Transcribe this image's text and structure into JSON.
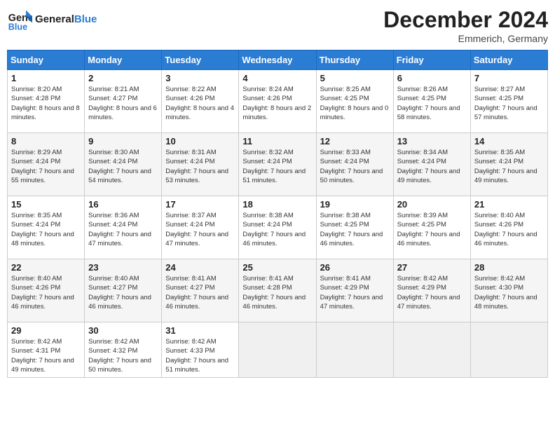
{
  "header": {
    "logo_text_1": "General",
    "logo_text_2": "Blue",
    "month": "December 2024",
    "location": "Emmerich, Germany"
  },
  "weekdays": [
    "Sunday",
    "Monday",
    "Tuesday",
    "Wednesday",
    "Thursday",
    "Friday",
    "Saturday"
  ],
  "weeks": [
    [
      {
        "day": "1",
        "sunrise": "8:20 AM",
        "sunset": "4:28 PM",
        "daylight": "8 hours and 8 minutes."
      },
      {
        "day": "2",
        "sunrise": "8:21 AM",
        "sunset": "4:27 PM",
        "daylight": "8 hours and 6 minutes."
      },
      {
        "day": "3",
        "sunrise": "8:22 AM",
        "sunset": "4:26 PM",
        "daylight": "8 hours and 4 minutes."
      },
      {
        "day": "4",
        "sunrise": "8:24 AM",
        "sunset": "4:26 PM",
        "daylight": "8 hours and 2 minutes."
      },
      {
        "day": "5",
        "sunrise": "8:25 AM",
        "sunset": "4:25 PM",
        "daylight": "8 hours and 0 minutes."
      },
      {
        "day": "6",
        "sunrise": "8:26 AM",
        "sunset": "4:25 PM",
        "daylight": "7 hours and 58 minutes."
      },
      {
        "day": "7",
        "sunrise": "8:27 AM",
        "sunset": "4:25 PM",
        "daylight": "7 hours and 57 minutes."
      }
    ],
    [
      {
        "day": "8",
        "sunrise": "8:29 AM",
        "sunset": "4:24 PM",
        "daylight": "7 hours and 55 minutes."
      },
      {
        "day": "9",
        "sunrise": "8:30 AM",
        "sunset": "4:24 PM",
        "daylight": "7 hours and 54 minutes."
      },
      {
        "day": "10",
        "sunrise": "8:31 AM",
        "sunset": "4:24 PM",
        "daylight": "7 hours and 53 minutes."
      },
      {
        "day": "11",
        "sunrise": "8:32 AM",
        "sunset": "4:24 PM",
        "daylight": "7 hours and 51 minutes."
      },
      {
        "day": "12",
        "sunrise": "8:33 AM",
        "sunset": "4:24 PM",
        "daylight": "7 hours and 50 minutes."
      },
      {
        "day": "13",
        "sunrise": "8:34 AM",
        "sunset": "4:24 PM",
        "daylight": "7 hours and 49 minutes."
      },
      {
        "day": "14",
        "sunrise": "8:35 AM",
        "sunset": "4:24 PM",
        "daylight": "7 hours and 49 minutes."
      }
    ],
    [
      {
        "day": "15",
        "sunrise": "8:35 AM",
        "sunset": "4:24 PM",
        "daylight": "7 hours and 48 minutes."
      },
      {
        "day": "16",
        "sunrise": "8:36 AM",
        "sunset": "4:24 PM",
        "daylight": "7 hours and 47 minutes."
      },
      {
        "day": "17",
        "sunrise": "8:37 AM",
        "sunset": "4:24 PM",
        "daylight": "7 hours and 47 minutes."
      },
      {
        "day": "18",
        "sunrise": "8:38 AM",
        "sunset": "4:24 PM",
        "daylight": "7 hours and 46 minutes."
      },
      {
        "day": "19",
        "sunrise": "8:38 AM",
        "sunset": "4:25 PM",
        "daylight": "7 hours and 46 minutes."
      },
      {
        "day": "20",
        "sunrise": "8:39 AM",
        "sunset": "4:25 PM",
        "daylight": "7 hours and 46 minutes."
      },
      {
        "day": "21",
        "sunrise": "8:40 AM",
        "sunset": "4:26 PM",
        "daylight": "7 hours and 46 minutes."
      }
    ],
    [
      {
        "day": "22",
        "sunrise": "8:40 AM",
        "sunset": "4:26 PM",
        "daylight": "7 hours and 46 minutes."
      },
      {
        "day": "23",
        "sunrise": "8:40 AM",
        "sunset": "4:27 PM",
        "daylight": "7 hours and 46 minutes."
      },
      {
        "day": "24",
        "sunrise": "8:41 AM",
        "sunset": "4:27 PM",
        "daylight": "7 hours and 46 minutes."
      },
      {
        "day": "25",
        "sunrise": "8:41 AM",
        "sunset": "4:28 PM",
        "daylight": "7 hours and 46 minutes."
      },
      {
        "day": "26",
        "sunrise": "8:41 AM",
        "sunset": "4:29 PM",
        "daylight": "7 hours and 47 minutes."
      },
      {
        "day": "27",
        "sunrise": "8:42 AM",
        "sunset": "4:29 PM",
        "daylight": "7 hours and 47 minutes."
      },
      {
        "day": "28",
        "sunrise": "8:42 AM",
        "sunset": "4:30 PM",
        "daylight": "7 hours and 48 minutes."
      }
    ],
    [
      {
        "day": "29",
        "sunrise": "8:42 AM",
        "sunset": "4:31 PM",
        "daylight": "7 hours and 49 minutes."
      },
      {
        "day": "30",
        "sunrise": "8:42 AM",
        "sunset": "4:32 PM",
        "daylight": "7 hours and 50 minutes."
      },
      {
        "day": "31",
        "sunrise": "8:42 AM",
        "sunset": "4:33 PM",
        "daylight": "7 hours and 51 minutes."
      },
      null,
      null,
      null,
      null
    ]
  ],
  "labels": {
    "sunrise": "Sunrise:",
    "sunset": "Sunset:",
    "daylight": "Daylight:"
  }
}
